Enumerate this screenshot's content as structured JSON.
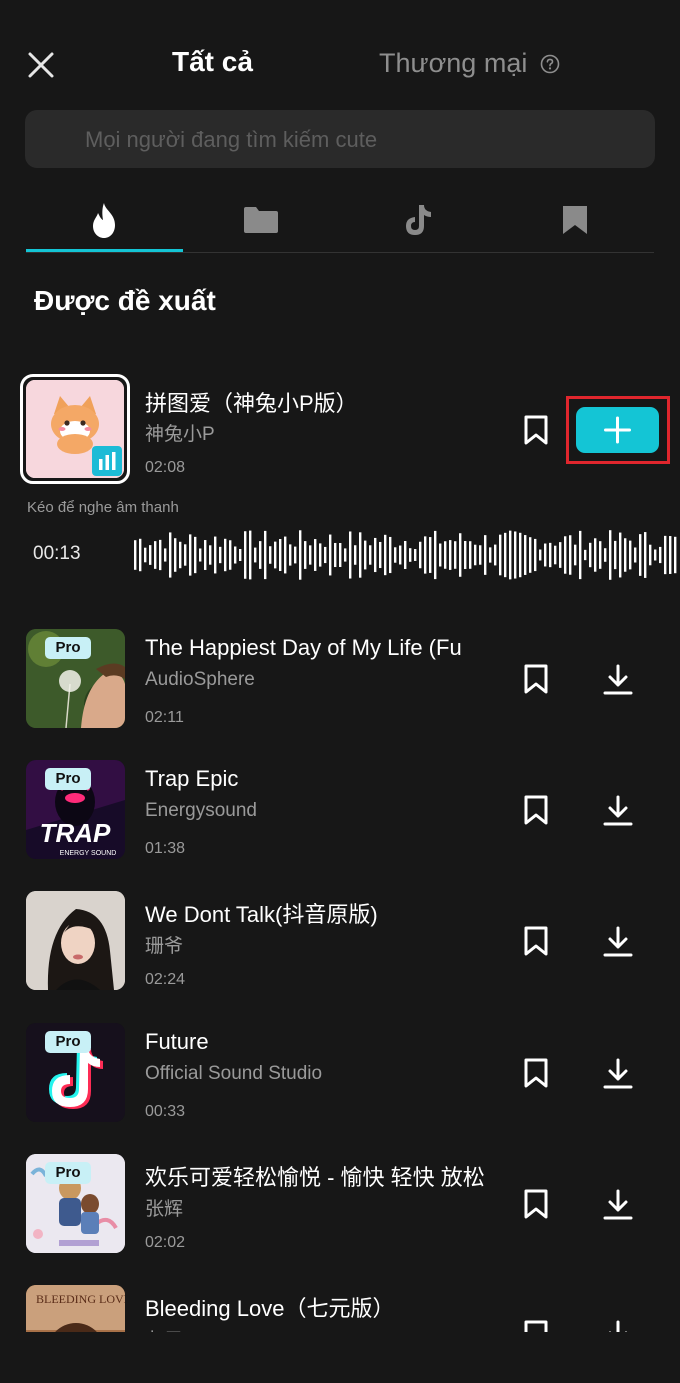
{
  "header": {
    "tab_all": "Tất cả",
    "tab_commercial": "Thương mại"
  },
  "search": {
    "placeholder": "Mọi người đang tìm kiếm cute"
  },
  "category_tabs": [
    {
      "icon": "flame-icon",
      "active": true
    },
    {
      "icon": "folder-icon",
      "active": false
    },
    {
      "icon": "tiktok-icon",
      "active": false
    },
    {
      "icon": "bookmark-icon",
      "active": false
    }
  ],
  "section_title": "Được đề xuất",
  "selected_track": {
    "title": "拼图爱（神兔小P版）",
    "artist": "神兔小P",
    "duration": "02:08",
    "drag_hint": "Kéo để nghe âm thanh",
    "playhead_time": "00:13"
  },
  "tracks": [
    {
      "title": "The Happiest Day of My Life (Fu",
      "artist": "AudioSphere",
      "duration": "02:11",
      "badge": "Pro"
    },
    {
      "title": "Trap Epic",
      "artist": "Energysound",
      "duration": "01:38",
      "badge": "Pro",
      "thumb_text": "TRAP",
      "thumb_subtext": "ENERGY SOUND"
    },
    {
      "title": "We Dont Talk(抖音原版)",
      "artist": "珊爷",
      "duration": "02:24"
    },
    {
      "title": "Future",
      "artist": "Official Sound Studio",
      "duration": "00:33",
      "badge": "Pro"
    },
    {
      "title": "欢乐可爱轻松愉悦 - 愉快 轻快 放松",
      "artist": "张辉",
      "duration": "02:02",
      "badge": "Pro"
    },
    {
      "title": "Bleeding Love（七元版）",
      "artist": "七元",
      "thumb_text": "BLEEDING LOVE"
    }
  ],
  "colors": {
    "accent": "#14c5d5",
    "highlight": "#e0262d",
    "background": "#171717"
  }
}
